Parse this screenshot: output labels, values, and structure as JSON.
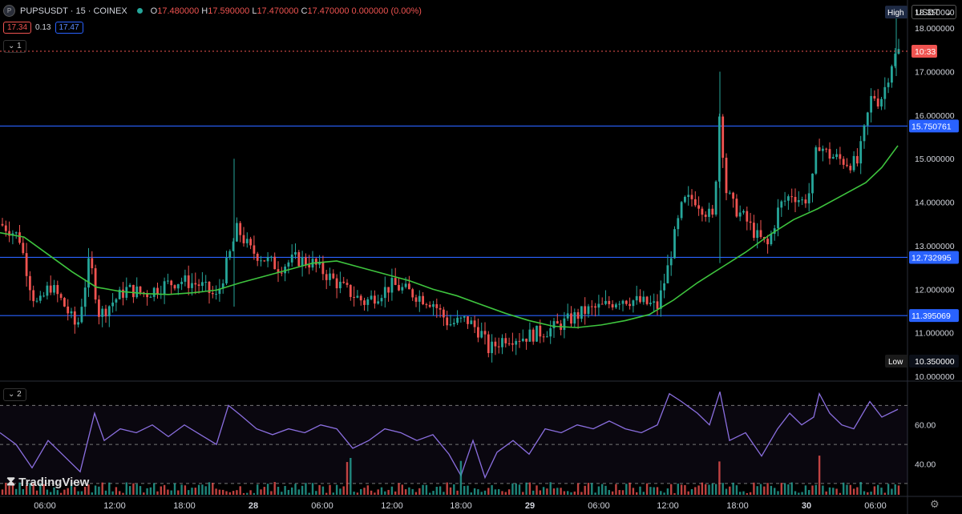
{
  "header": {
    "symbol_icon": "P",
    "symbol": "PUPSUSDT · 15 · COINEX",
    "ohlc": {
      "o_label": "O",
      "o": "17.480000",
      "h_label": "H",
      "h": "17.590000",
      "l_label": "L",
      "l": "17.470000",
      "c_label": "C",
      "c": "17.470000",
      "change": "0.000000 (0.00%)"
    },
    "sell_price": "17.34",
    "spread": "0.13",
    "buy_price": "17.47",
    "pane1_collapse": "1",
    "pane2_collapse": "2"
  },
  "currency": "USDT",
  "price_axis": {
    "ticks": [
      "18.000000",
      "17.000000",
      "16.000000",
      "15.000000",
      "14.000000",
      "13.000000",
      "12.000000",
      "11.000000",
      "10.000000"
    ],
    "high_label": "High",
    "high_value": "18.350000",
    "low_label": "Low",
    "low_value": "10.350000",
    "current_time_label": "10:33",
    "current_price": 17.47,
    "hlines": [
      {
        "price": 15.750761,
        "label": "15.750761"
      },
      {
        "price": 12.732995,
        "label": "12.732995"
      },
      {
        "price": 11.395069,
        "label": "11.395069"
      }
    ]
  },
  "rsi_axis": {
    "ticks": [
      "60.00",
      "40.00"
    ]
  },
  "time_axis": [
    "06:00",
    "12:00",
    "18:00",
    "28",
    "06:00",
    "12:00",
    "18:00",
    "29",
    "06:00",
    "12:00",
    "18:00",
    "30",
    "06:00"
  ],
  "watermark": "TradingView",
  "colors": {
    "up": "#26a69a",
    "down": "#ef5350",
    "ma": "#3ec43e",
    "rsi": "#8b6fe0",
    "hline": "#2962ff"
  },
  "chart_data": {
    "type": "candlestick",
    "interval": "15",
    "ylim": [
      10.0,
      18.5
    ],
    "price_path": [
      [
        0,
        13.5
      ],
      [
        10,
        13.4
      ],
      [
        24,
        13.2
      ],
      [
        40,
        11.9
      ],
      [
        48,
        11.6
      ],
      [
        62,
        12.1
      ],
      [
        78,
        11.7
      ],
      [
        96,
        11.1
      ],
      [
        112,
        12.7
      ],
      [
        124,
        11.4
      ],
      [
        140,
        11.7
      ],
      [
        158,
        12.0
      ],
      [
        182,
        11.9
      ],
      [
        205,
        12.1
      ],
      [
        225,
        12.2
      ],
      [
        250,
        12.1
      ],
      [
        270,
        11.8
      ],
      [
        285,
        12.7
      ],
      [
        296,
        13.4
      ],
      [
        312,
        12.9
      ],
      [
        330,
        12.7
      ],
      [
        348,
        12.5
      ],
      [
        368,
        12.7
      ],
      [
        390,
        12.6
      ],
      [
        410,
        12.3
      ],
      [
        430,
        12.0
      ],
      [
        455,
        11.7
      ],
      [
        472,
        11.9
      ],
      [
        490,
        12.1
      ],
      [
        515,
        11.9
      ],
      [
        540,
        11.7
      ],
      [
        560,
        11.2
      ],
      [
        582,
        11.3
      ],
      [
        600,
        11.0
      ],
      [
        610,
        10.6
      ],
      [
        630,
        10.9
      ],
      [
        652,
        10.9
      ],
      [
        672,
        11.0
      ],
      [
        690,
        11.1
      ],
      [
        710,
        11.3
      ],
      [
        730,
        11.5
      ],
      [
        752,
        11.6
      ],
      [
        775,
        11.8
      ],
      [
        800,
        11.7
      ],
      [
        820,
        11.6
      ],
      [
        832,
        12.4
      ],
      [
        840,
        13.1
      ],
      [
        852,
        14.0
      ],
      [
        866,
        14.1
      ],
      [
        880,
        13.8
      ],
      [
        890,
        13.6
      ],
      [
        898,
        16.2
      ],
      [
        905,
        14.3
      ],
      [
        915,
        13.9
      ],
      [
        930,
        13.6
      ],
      [
        945,
        13.2
      ],
      [
        958,
        13.0
      ],
      [
        972,
        13.9
      ],
      [
        988,
        14.2
      ],
      [
        1002,
        14.0
      ],
      [
        1012,
        14.3
      ],
      [
        1020,
        15.4
      ],
      [
        1032,
        15.1
      ],
      [
        1045,
        15.0
      ],
      [
        1060,
        14.9
      ],
      [
        1070,
        14.9
      ],
      [
        1080,
        15.8
      ],
      [
        1088,
        16.5
      ],
      [
        1097,
        16.3
      ],
      [
        1105,
        16.7
      ],
      [
        1112,
        17.2
      ],
      [
        1120,
        17.47
      ]
    ],
    "ma_path": [
      [
        0,
        13.3
      ],
      [
        30,
        13.2
      ],
      [
        60,
        12.8
      ],
      [
        90,
        12.4
      ],
      [
        120,
        12.05
      ],
      [
        150,
        11.95
      ],
      [
        180,
        11.9
      ],
      [
        210,
        11.88
      ],
      [
        240,
        11.92
      ],
      [
        270,
        11.98
      ],
      [
        300,
        12.15
      ],
      [
        330,
        12.3
      ],
      [
        360,
        12.45
      ],
      [
        390,
        12.6
      ],
      [
        420,
        12.65
      ],
      [
        450,
        12.5
      ],
      [
        480,
        12.35
      ],
      [
        510,
        12.2
      ],
      [
        540,
        12.0
      ],
      [
        570,
        11.85
      ],
      [
        600,
        11.65
      ],
      [
        630,
        11.45
      ],
      [
        660,
        11.28
      ],
      [
        690,
        11.15
      ],
      [
        720,
        11.12
      ],
      [
        750,
        11.18
      ],
      [
        780,
        11.28
      ],
      [
        810,
        11.42
      ],
      [
        840,
        11.75
      ],
      [
        870,
        12.15
      ],
      [
        900,
        12.5
      ],
      [
        930,
        12.85
      ],
      [
        960,
        13.25
      ],
      [
        990,
        13.6
      ],
      [
        1020,
        13.85
      ],
      [
        1050,
        14.15
      ],
      [
        1080,
        14.45
      ],
      [
        1100,
        14.8
      ],
      [
        1120,
        15.3
      ]
    ],
    "rsi": {
      "ylim": [
        25,
        80
      ],
      "bands": [
        70,
        50,
        30
      ],
      "path": [
        [
          0,
          56
        ],
        [
          20,
          50
        ],
        [
          40,
          38
        ],
        [
          60,
          52
        ],
        [
          80,
          44
        ],
        [
          100,
          36
        ],
        [
          118,
          66
        ],
        [
          130,
          52
        ],
        [
          150,
          58
        ],
        [
          170,
          56
        ],
        [
          190,
          60
        ],
        [
          210,
          54
        ],
        [
          230,
          60
        ],
        [
          250,
          55
        ],
        [
          270,
          50
        ],
        [
          285,
          70
        ],
        [
          300,
          65
        ],
        [
          320,
          58
        ],
        [
          340,
          55
        ],
        [
          360,
          58
        ],
        [
          380,
          56
        ],
        [
          400,
          60
        ],
        [
          420,
          58
        ],
        [
          440,
          48
        ],
        [
          460,
          52
        ],
        [
          480,
          58
        ],
        [
          500,
          56
        ],
        [
          520,
          52
        ],
        [
          540,
          55
        ],
        [
          560,
          45
        ],
        [
          575,
          34
        ],
        [
          590,
          52
        ],
        [
          605,
          33
        ],
        [
          620,
          46
        ],
        [
          640,
          52
        ],
        [
          660,
          45
        ],
        [
          680,
          58
        ],
        [
          700,
          56
        ],
        [
          720,
          60
        ],
        [
          740,
          58
        ],
        [
          760,
          62
        ],
        [
          780,
          58
        ],
        [
          800,
          56
        ],
        [
          820,
          60
        ],
        [
          835,
          76
        ],
        [
          850,
          72
        ],
        [
          870,
          66
        ],
        [
          885,
          60
        ],
        [
          898,
          77
        ],
        [
          910,
          52
        ],
        [
          930,
          56
        ],
        [
          950,
          44
        ],
        [
          970,
          58
        ],
        [
          985,
          66
        ],
        [
          1000,
          60
        ],
        [
          1015,
          64
        ],
        [
          1022,
          76
        ],
        [
          1035,
          66
        ],
        [
          1050,
          60
        ],
        [
          1065,
          58
        ],
        [
          1085,
          72
        ],
        [
          1100,
          64
        ],
        [
          1120,
          68
        ]
      ]
    }
  }
}
